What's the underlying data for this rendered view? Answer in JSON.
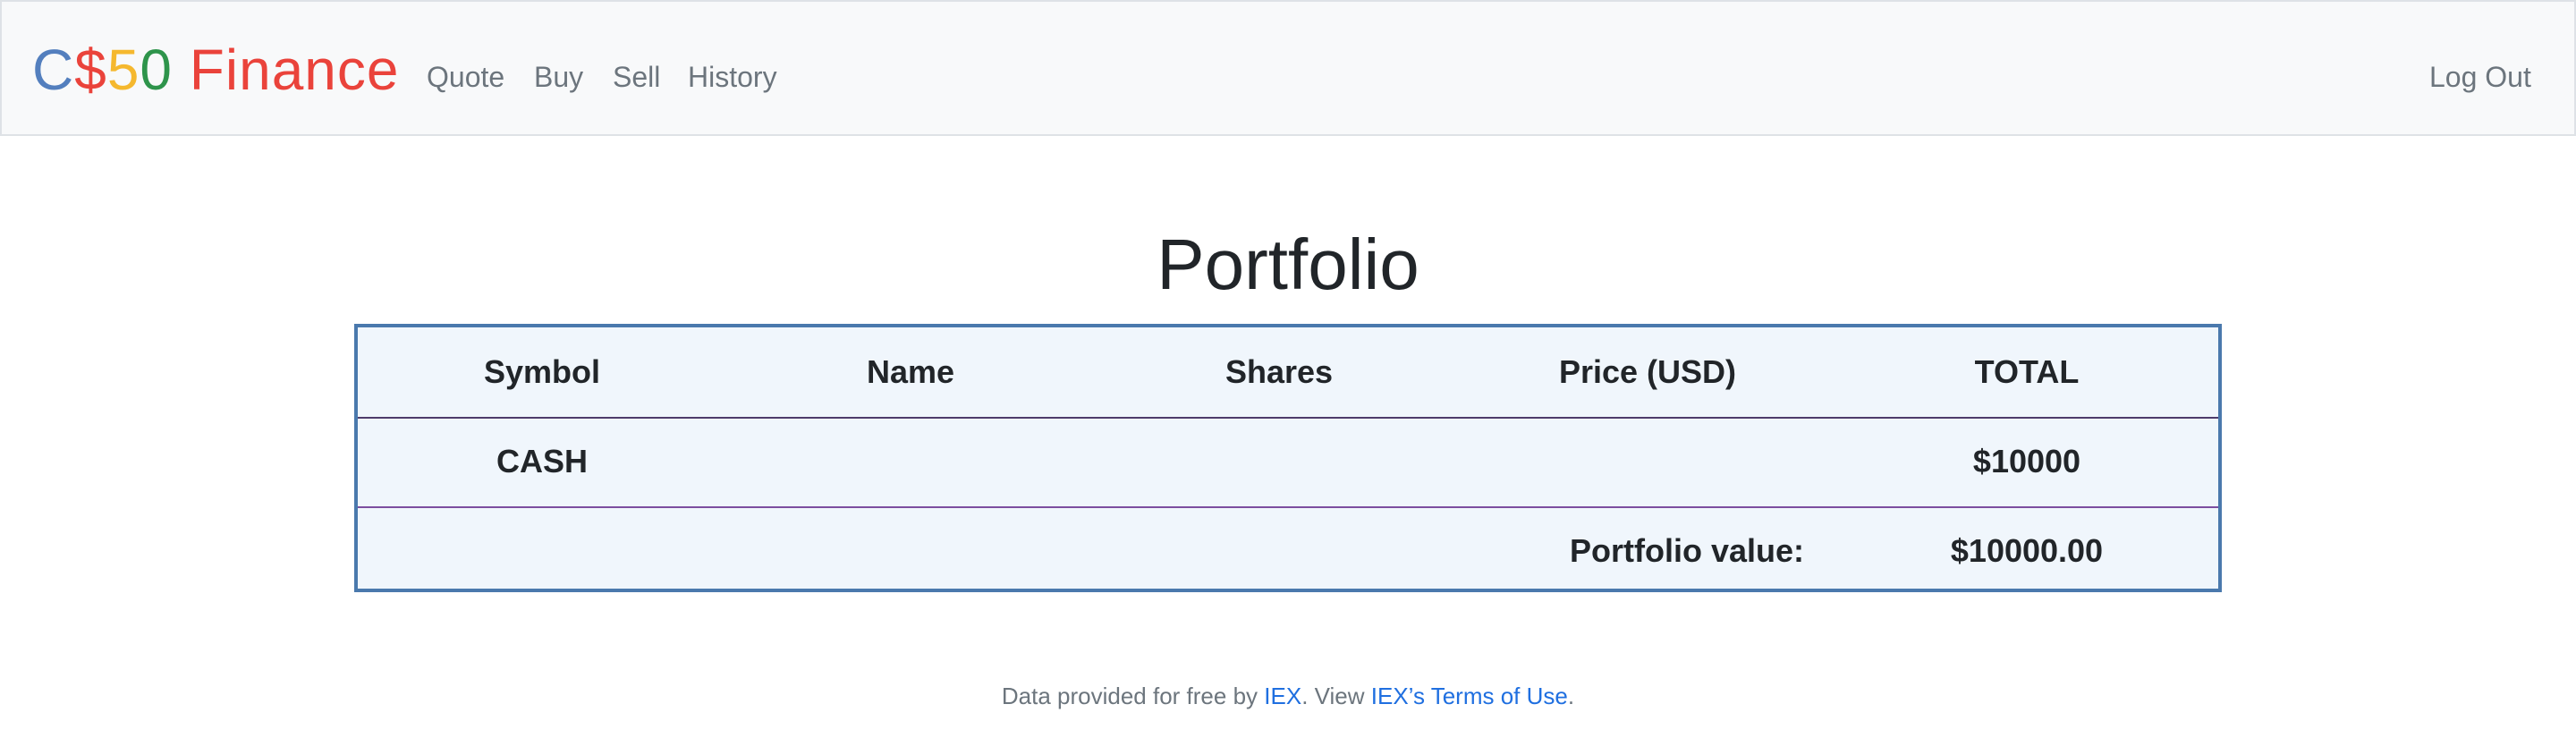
{
  "navbar": {
    "brand": {
      "part1": "C",
      "part2": "$",
      "part3": "5",
      "part4": "0",
      "part5": " Finance"
    },
    "links": {
      "quote": "Quote",
      "buy": "Buy",
      "sell": "Sell",
      "history": "History"
    },
    "logout": "Log Out"
  },
  "main": {
    "title": "Portfolio",
    "table": {
      "headers": {
        "symbol": "Symbol",
        "name": "Name",
        "shares": "Shares",
        "price": "Price (USD)",
        "total": "TOTAL"
      },
      "cash_row": {
        "symbol": "CASH",
        "name": "",
        "shares": "",
        "price": "",
        "total": "$10000"
      },
      "summary_row": {
        "label": "Portfolio value:",
        "value": "$10000.00"
      }
    }
  },
  "footer": {
    "text1": "Data provided for free by ",
    "link1": "IEX",
    "text2": ". View ",
    "link2": "IEX’s Terms of Use",
    "text3": "."
  },
  "colors": {
    "brand_c": "#537fbe",
    "brand_dollar": "#ea433b",
    "brand_5": "#f5b82e",
    "brand_0": "#2e944b",
    "brand_finance": "#ea433b",
    "table_border": "#4a79ad",
    "table_bg": "#f0f6fc",
    "link": "#1f6fe0"
  }
}
